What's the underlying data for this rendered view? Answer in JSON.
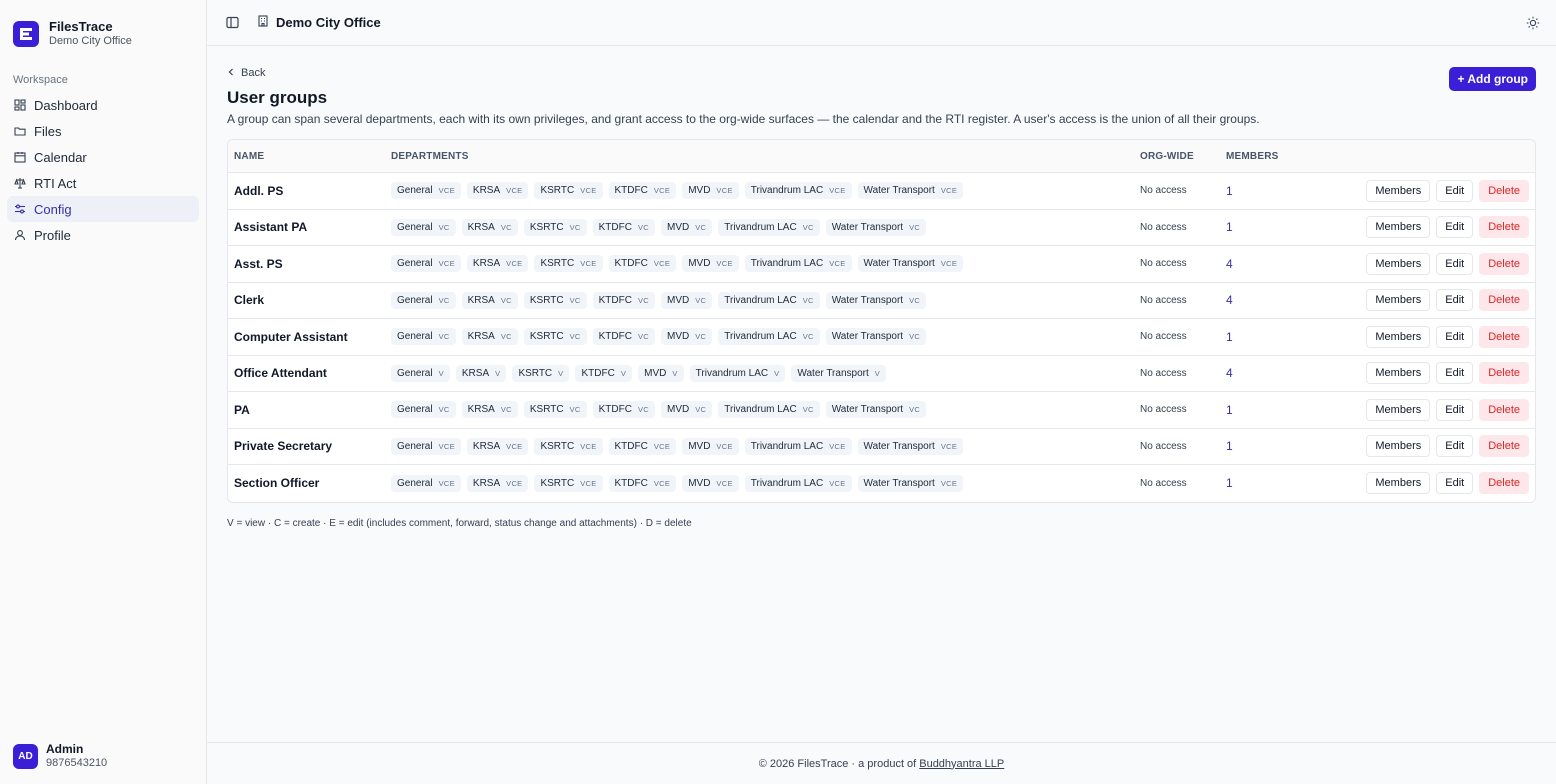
{
  "brand": {
    "app_name": "FilesTrace",
    "org_name": "Demo City Office",
    "logo_color": "#3a1fd6"
  },
  "sidebar": {
    "section_label": "Workspace",
    "items": [
      {
        "label": "Dashboard",
        "icon": "dashboard-icon",
        "active": false
      },
      {
        "label": "Files",
        "icon": "folder-icon",
        "active": false
      },
      {
        "label": "Calendar",
        "icon": "calendar-icon",
        "active": false
      },
      {
        "label": "RTI Act",
        "icon": "scale-icon",
        "active": false
      },
      {
        "label": "Config",
        "icon": "sliders-icon",
        "active": true
      },
      {
        "label": "Profile",
        "icon": "user-icon",
        "active": false
      }
    ],
    "user": {
      "initials": "AD",
      "name": "Admin",
      "phone": "9876543210"
    }
  },
  "topbar": {
    "title": "Demo City Office",
    "sidebar_toggle_icon": "sidebar-toggle-icon",
    "theme_icon": "sun-icon"
  },
  "page": {
    "back_label": "Back",
    "title": "User groups",
    "description": "A group can span several departments, each with its own privileges, and grant access to the org-wide surfaces — the calendar and the RTI register. A user's access is the union of all their groups.",
    "add_button": "+ Add group"
  },
  "table": {
    "headers": {
      "name": "NAME",
      "departments": "DEPARTMENTS",
      "org_wide": "ORG-WIDE",
      "members": "MEMBERS"
    },
    "actions": {
      "members": "Members",
      "edit": "Edit",
      "delete": "Delete"
    },
    "rows": [
      {
        "name": "Addl. PS",
        "depts": [
          [
            "General",
            "VCE"
          ],
          [
            "KRSA",
            "VCE"
          ],
          [
            "KSRTC",
            "VCE"
          ],
          [
            "KTDFC",
            "VCE"
          ],
          [
            "MVD",
            "VCE"
          ],
          [
            "Trivandrum LAC",
            "VCE"
          ],
          [
            "Water Transport",
            "VCE"
          ]
        ],
        "org": "No access",
        "members": "1"
      },
      {
        "name": "Assistant PA",
        "depts": [
          [
            "General",
            "VC"
          ],
          [
            "KRSA",
            "VC"
          ],
          [
            "KSRTC",
            "VC"
          ],
          [
            "KTDFC",
            "VC"
          ],
          [
            "MVD",
            "VC"
          ],
          [
            "Trivandrum LAC",
            "VC"
          ],
          [
            "Water Transport",
            "VC"
          ]
        ],
        "org": "No access",
        "members": "1"
      },
      {
        "name": "Asst. PS",
        "depts": [
          [
            "General",
            "VCE"
          ],
          [
            "KRSA",
            "VCE"
          ],
          [
            "KSRTC",
            "VCE"
          ],
          [
            "KTDFC",
            "VCE"
          ],
          [
            "MVD",
            "VCE"
          ],
          [
            "Trivandrum LAC",
            "VCE"
          ],
          [
            "Water Transport",
            "VCE"
          ]
        ],
        "org": "No access",
        "members": "4"
      },
      {
        "name": "Clerk",
        "depts": [
          [
            "General",
            "VC"
          ],
          [
            "KRSA",
            "VC"
          ],
          [
            "KSRTC",
            "VC"
          ],
          [
            "KTDFC",
            "VC"
          ],
          [
            "MVD",
            "VC"
          ],
          [
            "Trivandrum LAC",
            "VC"
          ],
          [
            "Water Transport",
            "VC"
          ]
        ],
        "org": "No access",
        "members": "4"
      },
      {
        "name": "Computer Assistant",
        "depts": [
          [
            "General",
            "VC"
          ],
          [
            "KRSA",
            "VC"
          ],
          [
            "KSRTC",
            "VC"
          ],
          [
            "KTDFC",
            "VC"
          ],
          [
            "MVD",
            "VC"
          ],
          [
            "Trivandrum LAC",
            "VC"
          ],
          [
            "Water Transport",
            "VC"
          ]
        ],
        "org": "No access",
        "members": "1"
      },
      {
        "name": "Office Attendant",
        "depts": [
          [
            "General",
            "V"
          ],
          [
            "KRSA",
            "V"
          ],
          [
            "KSRTC",
            "V"
          ],
          [
            "KTDFC",
            "V"
          ],
          [
            "MVD",
            "V"
          ],
          [
            "Trivandrum LAC",
            "V"
          ],
          [
            "Water Transport",
            "V"
          ]
        ],
        "org": "No access",
        "members": "4"
      },
      {
        "name": "PA",
        "depts": [
          [
            "General",
            "VC"
          ],
          [
            "KRSA",
            "VC"
          ],
          [
            "KSRTC",
            "VC"
          ],
          [
            "KTDFC",
            "VC"
          ],
          [
            "MVD",
            "VC"
          ],
          [
            "Trivandrum LAC",
            "VC"
          ],
          [
            "Water Transport",
            "VC"
          ]
        ],
        "org": "No access",
        "members": "1"
      },
      {
        "name": "Private Secretary",
        "depts": [
          [
            "General",
            "VCE"
          ],
          [
            "KRSA",
            "VCE"
          ],
          [
            "KSRTC",
            "VCE"
          ],
          [
            "KTDFC",
            "VCE"
          ],
          [
            "MVD",
            "VCE"
          ],
          [
            "Trivandrum LAC",
            "VCE"
          ],
          [
            "Water Transport",
            "VCE"
          ]
        ],
        "org": "No access",
        "members": "1"
      },
      {
        "name": "Section Officer",
        "depts": [
          [
            "General",
            "VCE"
          ],
          [
            "KRSA",
            "VCE"
          ],
          [
            "KSRTC",
            "VCE"
          ],
          [
            "KTDFC",
            "VCE"
          ],
          [
            "MVD",
            "VCE"
          ],
          [
            "Trivandrum LAC",
            "VCE"
          ],
          [
            "Water Transport",
            "VCE"
          ]
        ],
        "org": "No access",
        "members": "1"
      }
    ]
  },
  "legend": "V = view · C = create · E = edit (includes comment, forward, status change and attachments) · D = delete",
  "footer": {
    "text": "© 2026 FilesTrace · a product of",
    "link": "Buddhyantra LLP"
  },
  "colors": {
    "accent": "#3a1fd6",
    "active_nav_bg": "#eef0f8",
    "delete_bg": "#fde7ea",
    "delete_text": "#dc2626"
  }
}
